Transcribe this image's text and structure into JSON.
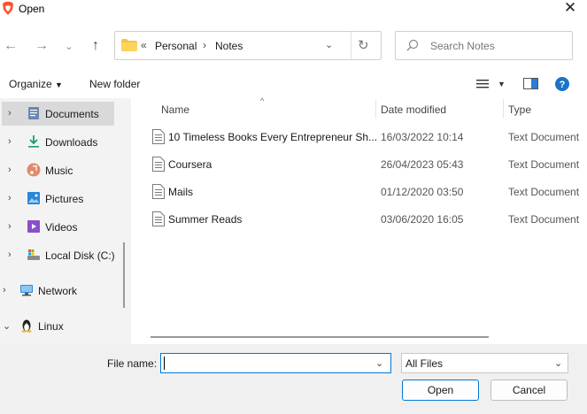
{
  "window": {
    "title": "Open"
  },
  "nav": {
    "back": "←",
    "forward": "→",
    "recent": "⌄",
    "up": "↑"
  },
  "address": {
    "overflow": "«",
    "crumbs": [
      "Personal",
      "Notes"
    ],
    "separator": "›"
  },
  "search": {
    "placeholder": "Search Notes"
  },
  "toolbar": {
    "organize_label": "Organize",
    "new_folder_label": "New folder"
  },
  "sidebar": {
    "items": [
      {
        "label": "Documents",
        "icon": "documents-icon",
        "selected": true
      },
      {
        "label": "Downloads",
        "icon": "downloads-icon"
      },
      {
        "label": "Music",
        "icon": "music-icon"
      },
      {
        "label": "Pictures",
        "icon": "pictures-icon"
      },
      {
        "label": "Videos",
        "icon": "videos-icon"
      },
      {
        "label": "Local Disk (C:)",
        "icon": "drive-icon"
      },
      {
        "label": "Network",
        "icon": "network-icon"
      },
      {
        "label": "Linux",
        "icon": "linux-icon"
      }
    ]
  },
  "columns": {
    "name": "Name",
    "date": "Date modified",
    "type": "Type"
  },
  "files": [
    {
      "name": "10 Timeless Books Every Entrepreneur Sh...",
      "date": "16/03/2022 10:14",
      "type": "Text Document"
    },
    {
      "name": "Coursera",
      "date": "26/04/2023 05:43",
      "type": "Text Document"
    },
    {
      "name": "Mails",
      "date": "01/12/2020 03:50",
      "type": "Text Document"
    },
    {
      "name": "Summer Reads",
      "date": "03/06/2020 16:05",
      "type": "Text Document"
    }
  ],
  "bottom": {
    "file_name_label": "File name:",
    "file_name_value": "",
    "file_type_value": "All Files",
    "open_label": "Open",
    "cancel_label": "Cancel"
  },
  "colors": {
    "accent": "#0078d4",
    "sidebar_bg": "#f3f3f3",
    "selected_bg": "#d9d9d9",
    "bottom_bg": "#f0f0f0"
  }
}
